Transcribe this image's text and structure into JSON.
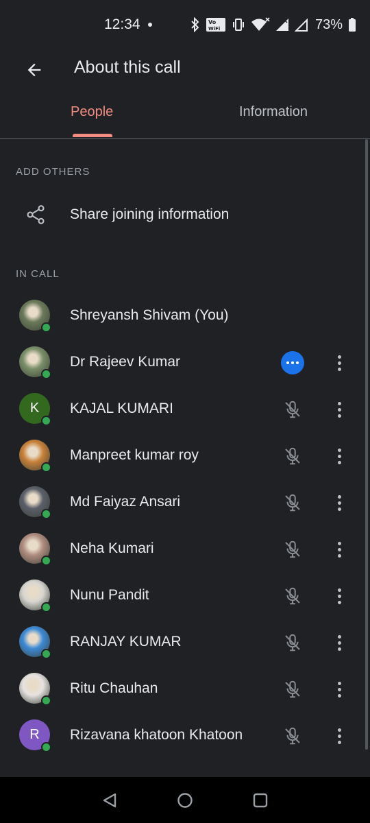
{
  "status_bar": {
    "time": "12:34",
    "battery_percent": "73%",
    "icons": [
      "bluetooth-icon",
      "volte-wifi-icon",
      "vibrate-icon",
      "wifi-icon",
      "signal-icon",
      "signal-icon",
      "battery-icon"
    ]
  },
  "header": {
    "title": "About this call",
    "back_icon": "arrow-back-icon"
  },
  "tabs": [
    {
      "label": "People",
      "selected": true
    },
    {
      "label": "Information",
      "selected": false
    }
  ],
  "add_others": {
    "section_label": "ADD OTHERS",
    "share_label": "Share joining information",
    "share_icon": "share-icon"
  },
  "in_call": {
    "section_label": "IN CALL",
    "participants": [
      {
        "name": "Shreyansh Shivam (You)",
        "avatar": "photo",
        "color": "#6b7a5a",
        "action": "none"
      },
      {
        "name": "Dr Rajeev Kumar",
        "avatar": "photo",
        "color": "#7a8f6a",
        "action": "more"
      },
      {
        "name": "KAJAL KUMARI",
        "avatar": "K",
        "color": "#33691e",
        "action": "muted"
      },
      {
        "name": "Manpreet kumar roy",
        "avatar": "photo",
        "color": "#c9823a",
        "action": "muted"
      },
      {
        "name": "Md Faiyaz Ansari",
        "avatar": "photo",
        "color": "#5b5f6a",
        "action": "muted"
      },
      {
        "name": "Neha Kumari",
        "avatar": "photo",
        "color": "#b08d80",
        "action": "muted"
      },
      {
        "name": "Nunu Pandit",
        "avatar": "photo",
        "color": "#d8d6d2",
        "action": "muted"
      },
      {
        "name": "RANJAY KUMAR",
        "avatar": "photo",
        "color": "#3d8ad6",
        "action": "muted"
      },
      {
        "name": "Ritu Chauhan",
        "avatar": "photo",
        "color": "#e6e2e0",
        "action": "muted"
      },
      {
        "name": "Rizavana khatoon Khatoon",
        "avatar": "R",
        "color": "#7e57c2",
        "action": "muted"
      }
    ]
  },
  "colors": {
    "background": "#202124",
    "accent": "#f28b82",
    "online": "#34a853",
    "active_blue": "#1a73e8"
  },
  "nav_bar": {
    "back": "nav-back-icon",
    "home": "nav-home-icon",
    "recents": "nav-recents-icon"
  }
}
